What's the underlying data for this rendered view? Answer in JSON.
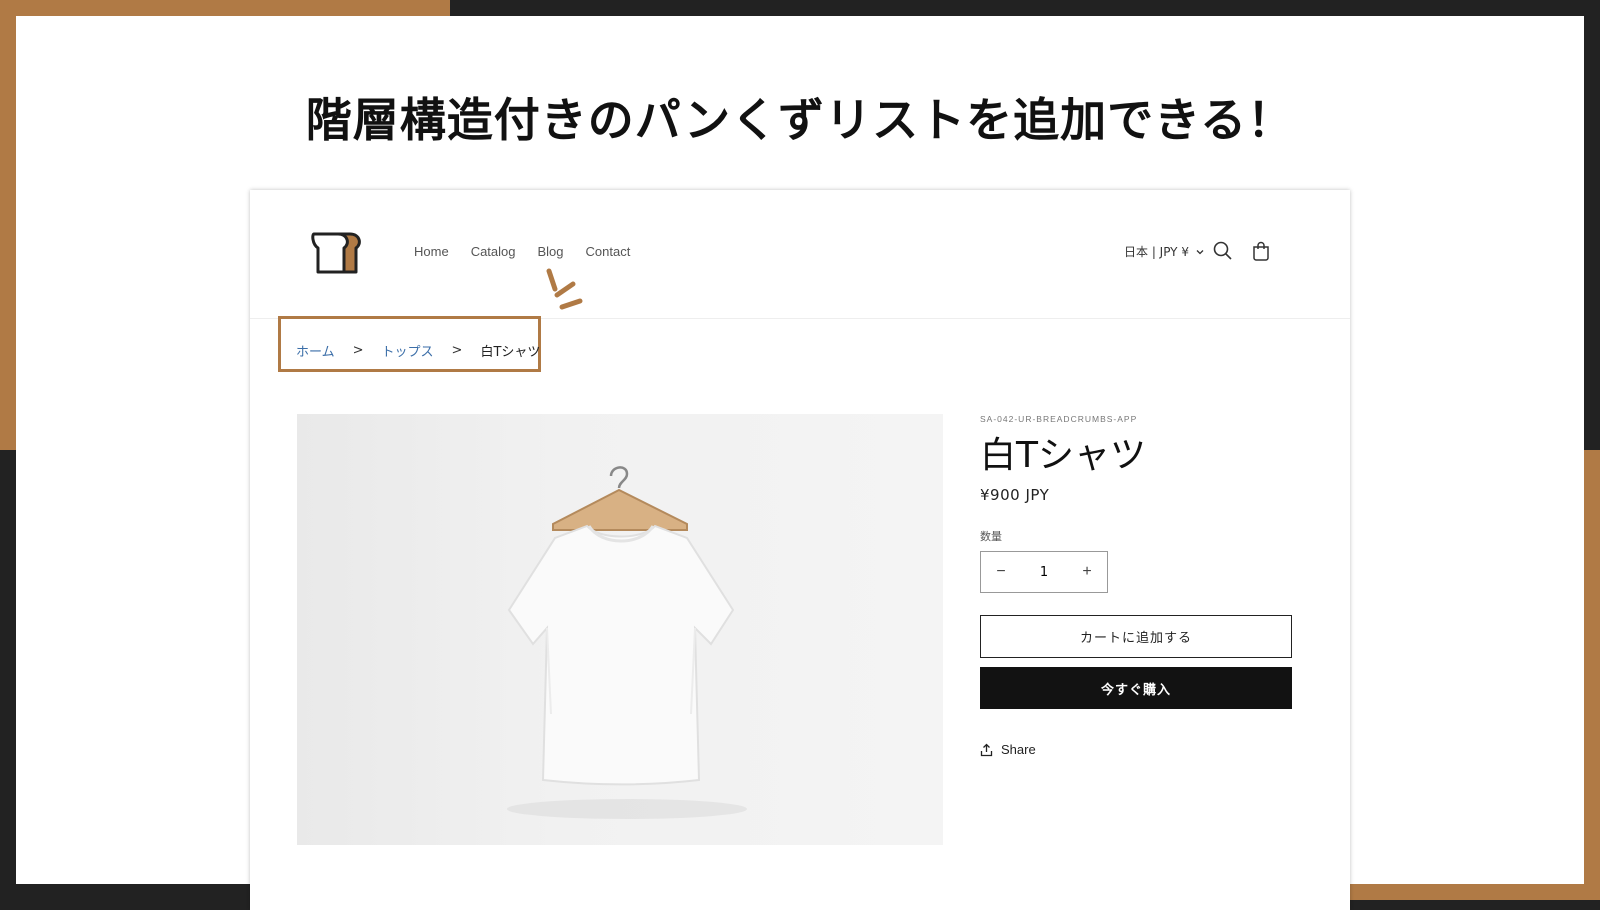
{
  "headline": "階層構造付きのパンくずリストを追加できる！",
  "colors": {
    "accent": "#b07a45",
    "dark": "#222222",
    "link": "#3b6ea8",
    "button_dark": "#121212"
  },
  "store": {
    "logo": "bread-logo-icon",
    "nav": [
      "Home",
      "Catalog",
      "Blog",
      "Contact"
    ],
    "locale": "日本 | JPY ¥",
    "icons": [
      "chevron-down-icon",
      "search-icon",
      "cart-icon"
    ]
  },
  "breadcrumb": {
    "items": [
      {
        "label": "ホーム",
        "link": true
      },
      {
        "label": "トップス",
        "link": true
      },
      {
        "label": "白Tシャツ",
        "link": false
      }
    ],
    "separator": ">"
  },
  "product": {
    "vendor": "SA-042-UR-BREADCRUMBS-APP",
    "title": "白Tシャツ",
    "price": "¥900 JPY",
    "quantity_label": "数量",
    "quantity": "1",
    "minus": "−",
    "plus": "+",
    "add_to_cart": "カートに追加する",
    "buy_now": "今すぐ購入",
    "share": "Share"
  }
}
